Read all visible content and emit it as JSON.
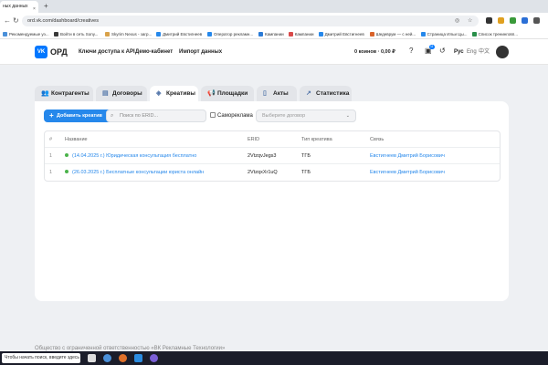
{
  "browser": {
    "tab_title": "ных данных",
    "tab_close": "×",
    "new_tab": "+",
    "url": "ord.vk.com/dashboard/creatives",
    "bookmarks": [
      {
        "label": "Рекомендуемые уэ...",
        "color": "#4a90d9"
      },
      {
        "label": "Войти в сеть Sony...",
        "color": "#3a3a3a"
      },
      {
        "label": "Skyrim Nexus - загр...",
        "color": "#d9a24a"
      },
      {
        "label": "Дмитрий Евстигнеев",
        "color": "#2688eb"
      },
      {
        "label": "Оператор рекламн...",
        "color": "#2688eb"
      },
      {
        "label": "Кампании",
        "color": "#2b7bd6"
      },
      {
        "label": "Кампании",
        "color": "#d94a4a"
      },
      {
        "label": "Дмитрий Евстигнеев",
        "color": "#2688eb"
      },
      {
        "label": "Шедеврум — с ней...",
        "color": "#d9632a"
      },
      {
        "label": "Страница Ильи Цы...",
        "color": "#2688eb"
      },
      {
        "label": "Список тренинговп...",
        "color": "#2a8f4a"
      }
    ]
  },
  "header": {
    "logo_badge": "VK",
    "logo_text": "ОРД",
    "nav": [
      "Ключи доступа к API",
      "Демо-кабинет",
      "Импорт данных"
    ],
    "coins": "0 коинов · 0,00 ₽",
    "notif_count": "11",
    "lang_active": "Рус",
    "lang_en": "Eng",
    "lang_cn": "中文"
  },
  "tabs": [
    {
      "label": "Контрагенты",
      "icon": "users-icon",
      "active": false
    },
    {
      "label": "Договоры",
      "icon": "document-icon",
      "active": false
    },
    {
      "label": "Креативы",
      "icon": "creative-icon",
      "active": true
    },
    {
      "label": "Площадки",
      "icon": "megaphone-icon",
      "active": false
    },
    {
      "label": "Акты",
      "icon": "file-icon",
      "active": false
    },
    {
      "label": "Статистика",
      "icon": "stats-icon",
      "active": false
    }
  ],
  "toolbar": {
    "add_label": "Добавить креатив",
    "search_placeholder": "Поиск по ERID...",
    "self_ad_label": "Самореклама",
    "contract_placeholder": "Выберите договор"
  },
  "table": {
    "columns": [
      "#",
      "Название",
      "ERID",
      "Тип креатива",
      "Связь"
    ],
    "rows": [
      {
        "num": "1",
        "name": "(14.04.2025 г.) Юридическая консультация бесплатно",
        "erid": "2VtzqvJegs3",
        "type": "ТГБ",
        "link": "Евстигнеев Дмитрий Борисович"
      },
      {
        "num": "1",
        "name": "(26.03.2025 г.) Бесплатные консультации юриста онлайн",
        "erid": "2VtzqxXr1uQ",
        "type": "ТГБ",
        "link": "Евстигнеев Дмитрий Борисович"
      }
    ]
  },
  "footer": {
    "text": "Общество с ограниченной ответственностью «ВК Рекламные Технологии»"
  },
  "taskbar": {
    "search": "Чтобы начать поиск, введите здесь запрос"
  },
  "colors": {
    "accent": "#2688eb",
    "active_dot": "#4bb34b"
  }
}
